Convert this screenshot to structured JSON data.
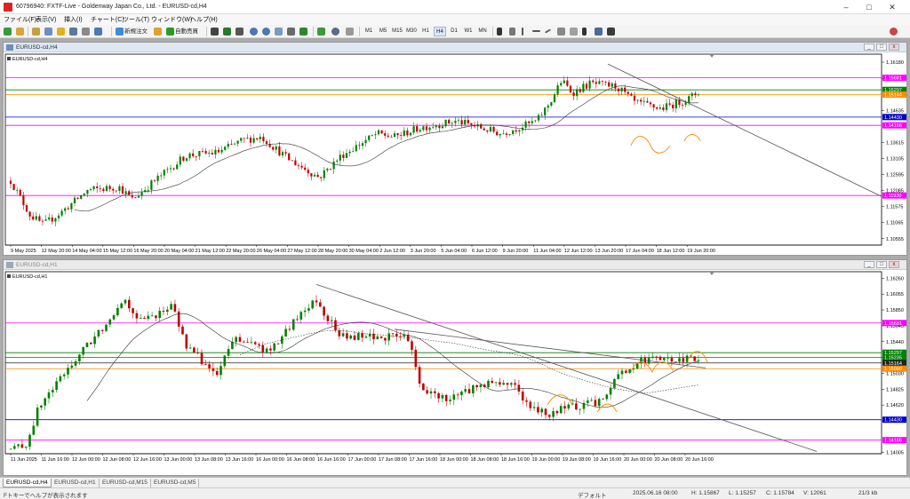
{
  "window": {
    "title": "60796940: FXTF-Live - Goldenway Japan Co., Ltd. - EURUSD-cd,H4"
  },
  "menu": [
    "ファイル(F)",
    "表示(V)",
    "挿入(I)",
    "チャート(C)",
    "ツール(T)",
    "ウィンドウ(W)",
    "ヘルプ(H)"
  ],
  "toolbar": {
    "new_order_label": "新規注文",
    "auto_trade_label": "自動売買",
    "timeframes": [
      "M1",
      "M5",
      "M15",
      "M30",
      "H1",
      "H4",
      "D1",
      "W1",
      "MN"
    ],
    "selected_timeframe": "H4"
  },
  "colors": {
    "bull": "#008000",
    "bear": "#c00000",
    "magenta": "#ff00ff",
    "green_level": "#008000",
    "orange_level": "#ff8c00",
    "blue_level": "#0000cc"
  },
  "chart_h4": {
    "window_title": "EURUSD-cd,H4",
    "symbol_label": "EURUSD-cd,H4",
    "y_axis_labels": [
      "1.16180",
      "1.15651",
      "1.14635",
      "1.13615",
      "1.13105",
      "1.12595",
      "1.12085",
      "1.11575",
      "1.11065",
      "1.10555"
    ],
    "level_labels": [
      "1.15681",
      "1.15297",
      "1.15144",
      "1.14430",
      "1.14166",
      "1.11930"
    ],
    "x_axis_labels": [
      "9 May 2025",
      "12 May 20:00",
      "14 May 04:00",
      "15 May 12:00",
      "16 May 20:00",
      "20 May 04:00",
      "21 May 12:00",
      "22 May 20:00",
      "26 May 04:00",
      "27 May 12:00",
      "28 May 20:00",
      "30 May 04:00",
      "2 Jun 12:00",
      "3 Jun 20:00",
      "5 Jun 04:00",
      "6 Jun 12:00",
      "9 Jun 20:00",
      "11 Jun 04:00",
      "12 Jun 12:00",
      "13 Jun 20:00",
      "17 Jun 04:00",
      "18 Jun 12:00",
      "19 Jun 20:00"
    ]
  },
  "chart_h1": {
    "window_title": "EURUSD-cd,H1",
    "symbol_label": "EURUSD-cd,H1",
    "y_axis_labels": [
      "1.16260",
      "1.16055",
      "1.15850",
      "1.15645",
      "1.15440",
      "1.15235",
      "1.15030",
      "1.14825",
      "1.14620",
      "1.14415",
      "1.14005"
    ],
    "level_labels": [
      "1.15681",
      "1.15297",
      "1.15235",
      "1.15164",
      "1.15090",
      "1.14430",
      "1.14166"
    ],
    "x_axis_labels": [
      "11 Jun 2025",
      "11 Jun 16:00",
      "12 Jun 00:00",
      "12 Jun 08:00",
      "12 Jun 16:00",
      "13 Jun 00:00",
      "13 Jun 08:00",
      "13 Jun 16:00",
      "16 Jun 00:00",
      "16 Jun 08:00",
      "16 Jun 16:00",
      "17 Jun 00:00",
      "17 Jun 08:00",
      "17 Jun 16:00",
      "18 Jun 00:00",
      "18 Jun 08:00",
      "18 Jun 16:00",
      "19 Jun 00:00",
      "19 Jun 08:00",
      "19 Jun 16:00",
      "20 Jun 00:00",
      "20 Jun 08:00",
      "20 Jun 16:00"
    ]
  },
  "tabs": [
    "EURUSD-cd,H4",
    "EURUSD-cd,H1",
    "EURUSD-cd,M15",
    "EURUSD-cd,M5"
  ],
  "status": {
    "message": "Fトキーでヘルプが表示されます",
    "profile": "デフォルト",
    "datetime": "2025.06.16 08:00",
    "high": "H: 1.15867",
    "low": "L: 1.15257",
    "close": "C: 1.15784",
    "volume": "V: 12061",
    "traffic": "21/3 kb"
  }
}
